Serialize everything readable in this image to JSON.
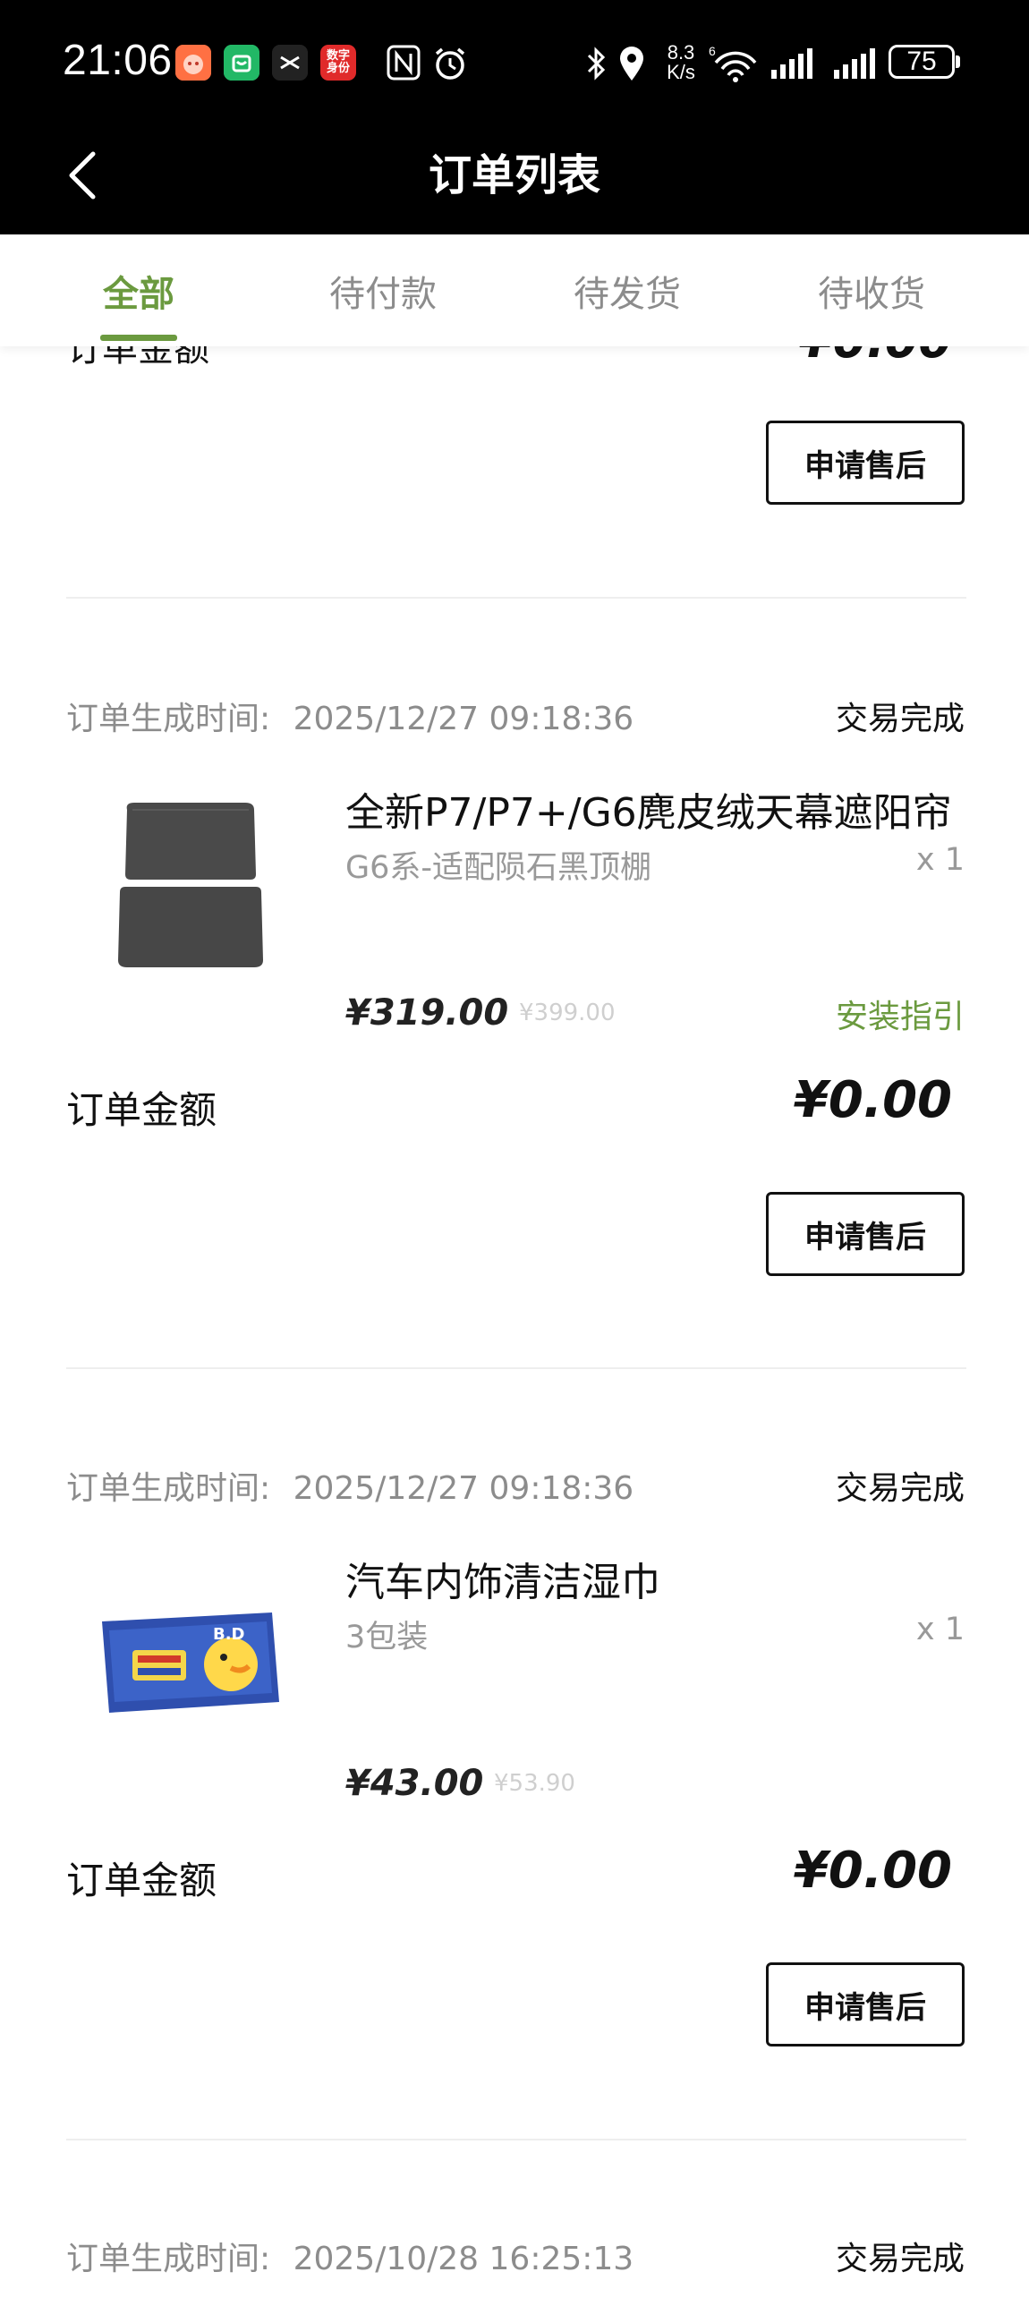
{
  "status_bar": {
    "time": "21:06",
    "app_icon_label": "数字身份",
    "net_speed_value": "8.3",
    "net_speed_unit": "K/s",
    "battery": "75"
  },
  "header": {
    "title": "订单列表"
  },
  "tabs": [
    {
      "label": "全部"
    },
    {
      "label": "待付款"
    },
    {
      "label": "待发货"
    },
    {
      "label": "待收货"
    }
  ],
  "labels": {
    "order_time_prefix": "订单生成时间:",
    "order_amount": "订单金额",
    "after_sale": "申请售后",
    "install_guide": "安装指引"
  },
  "partial_order": {
    "amount_label": "订单金额",
    "amount": "¥0.00"
  },
  "orders": [
    {
      "time": "2025/12/27 09:18:36",
      "status": "交易完成",
      "product_name": "全新P7/P7+/G6麂皮绒天幕遮阳帘",
      "variant": "G6系-适配陨石黑顶棚",
      "qty": "x 1",
      "price": "¥319.00",
      "original_price": "¥399.00",
      "amount": "¥0.00"
    },
    {
      "time": "2025/12/27 09:18:36",
      "status": "交易完成",
      "product_name": "汽车内饰清洁湿巾",
      "variant": "3包装",
      "qty": "x 1",
      "price": "¥43.00",
      "original_price": "¥53.90",
      "amount": "¥0.00"
    },
    {
      "time": "2025/10/28 16:25:13",
      "status": "交易完成"
    }
  ],
  "colors": {
    "accent": "#6b9a3f",
    "topbar": "#000000"
  },
  "icons": {
    "back": "chevron-left-icon"
  }
}
